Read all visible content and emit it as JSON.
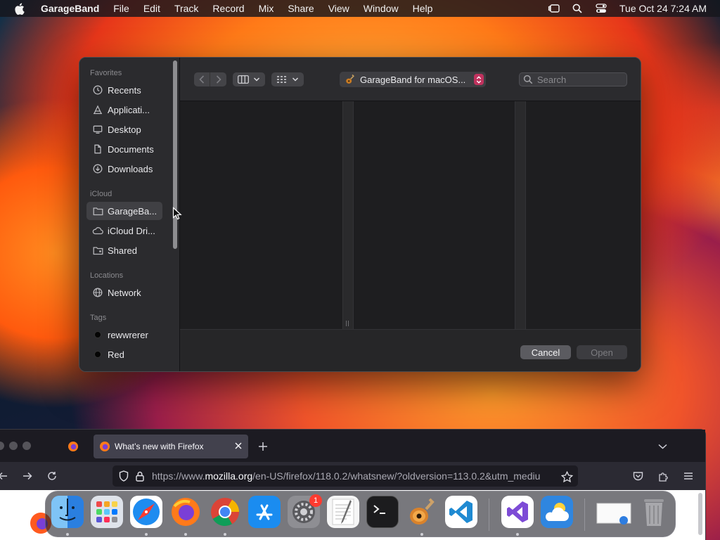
{
  "menubar": {
    "app": "GarageBand",
    "items": [
      "File",
      "Edit",
      "Track",
      "Record",
      "Mix",
      "Share",
      "View",
      "Window",
      "Help"
    ],
    "clock": "Tue Oct 24  7:24 AM"
  },
  "dialog": {
    "sidebar": {
      "favorites_label": "Favorites",
      "favorites": [
        {
          "label": "Recents",
          "icon": "clock-icon"
        },
        {
          "label": "Applicati...",
          "icon": "applications-icon"
        },
        {
          "label": "Desktop",
          "icon": "desktop-icon"
        },
        {
          "label": "Documents",
          "icon": "document-icon"
        },
        {
          "label": "Downloads",
          "icon": "download-icon"
        }
      ],
      "icloud_label": "iCloud",
      "icloud": [
        {
          "label": "GarageBa...",
          "icon": "folder-icon",
          "selected": true
        },
        {
          "label": "iCloud Dri...",
          "icon": "cloud-icon"
        },
        {
          "label": "Shared",
          "icon": "shared-folder-icon"
        }
      ],
      "locations_label": "Locations",
      "locations": [
        {
          "label": "Network",
          "icon": "globe-icon"
        }
      ],
      "tags_label": "Tags",
      "tags": [
        {
          "label": "rewwrerer",
          "color": "#000000"
        },
        {
          "label": "Red",
          "color": "#000000"
        }
      ]
    },
    "toolbar": {
      "location": "GarageBand for macOS...",
      "search_placeholder": "Search"
    },
    "buttons": {
      "cancel": "Cancel",
      "open": "Open"
    }
  },
  "firefox": {
    "tab_title": "What’s new with Firefox",
    "url": {
      "prefix": "https://www.",
      "host": "mozilla.org",
      "rest": "/en-US/firefox/118.0.2/whatsnew/?oldversion=113.0.2&utm_mediu"
    }
  },
  "dock": {
    "apps": [
      {
        "name": "Finder"
      },
      {
        "name": "Launchpad"
      },
      {
        "name": "Safari"
      },
      {
        "name": "Firefox"
      },
      {
        "name": "Chrome"
      },
      {
        "name": "App Store"
      },
      {
        "name": "System Settings",
        "badge": "1"
      },
      {
        "name": "TextEdit"
      },
      {
        "name": "Terminal"
      },
      {
        "name": "GarageBand"
      },
      {
        "name": "Visual Studio Code"
      },
      {
        "name": "Visual Studio"
      },
      {
        "name": "Weather"
      },
      {
        "name": "Window Preview"
      },
      {
        "name": "Trash"
      }
    ]
  },
  "colors": {
    "accent": "#c0325e",
    "cancel_bg": "#5b5b60"
  }
}
